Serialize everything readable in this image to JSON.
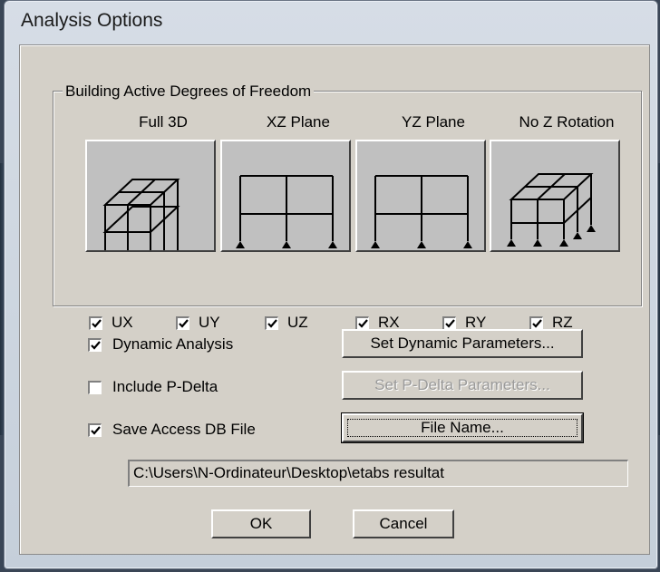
{
  "window": {
    "title": "Analysis Options"
  },
  "dof_group": {
    "legend": "Building Active Degrees of Freedom",
    "planes": [
      {
        "label": "Full 3D",
        "icon": "full-3d-frame-icon"
      },
      {
        "label": "XZ Plane",
        "icon": "xz-plane-frame-icon"
      },
      {
        "label": "YZ Plane",
        "icon": "yz-plane-frame-icon"
      },
      {
        "label": "No Z Rotation",
        "icon": "no-z-rotation-frame-icon"
      }
    ],
    "checkboxes": [
      {
        "label": "UX",
        "checked": true
      },
      {
        "label": "UY",
        "checked": true
      },
      {
        "label": "UZ",
        "checked": true
      },
      {
        "label": "RX",
        "checked": true
      },
      {
        "label": "RY",
        "checked": true
      },
      {
        "label": "RZ",
        "checked": true
      }
    ]
  },
  "options": {
    "dynamic_analysis": {
      "label": "Dynamic Analysis",
      "checked": true,
      "button": "Set Dynamic Parameters...",
      "button_enabled": true
    },
    "p_delta": {
      "label": "Include P-Delta",
      "checked": false,
      "button": "Set P-Delta Parameters...",
      "button_enabled": false
    },
    "save_db": {
      "label": "Save Access DB File",
      "checked": true,
      "button": "File Name...",
      "button_enabled": true
    }
  },
  "file_path": "C:\\Users\\N-Ordinateur\\Desktop\\etabs resultat",
  "footer": {
    "ok_label": "OK",
    "cancel_label": "Cancel"
  }
}
